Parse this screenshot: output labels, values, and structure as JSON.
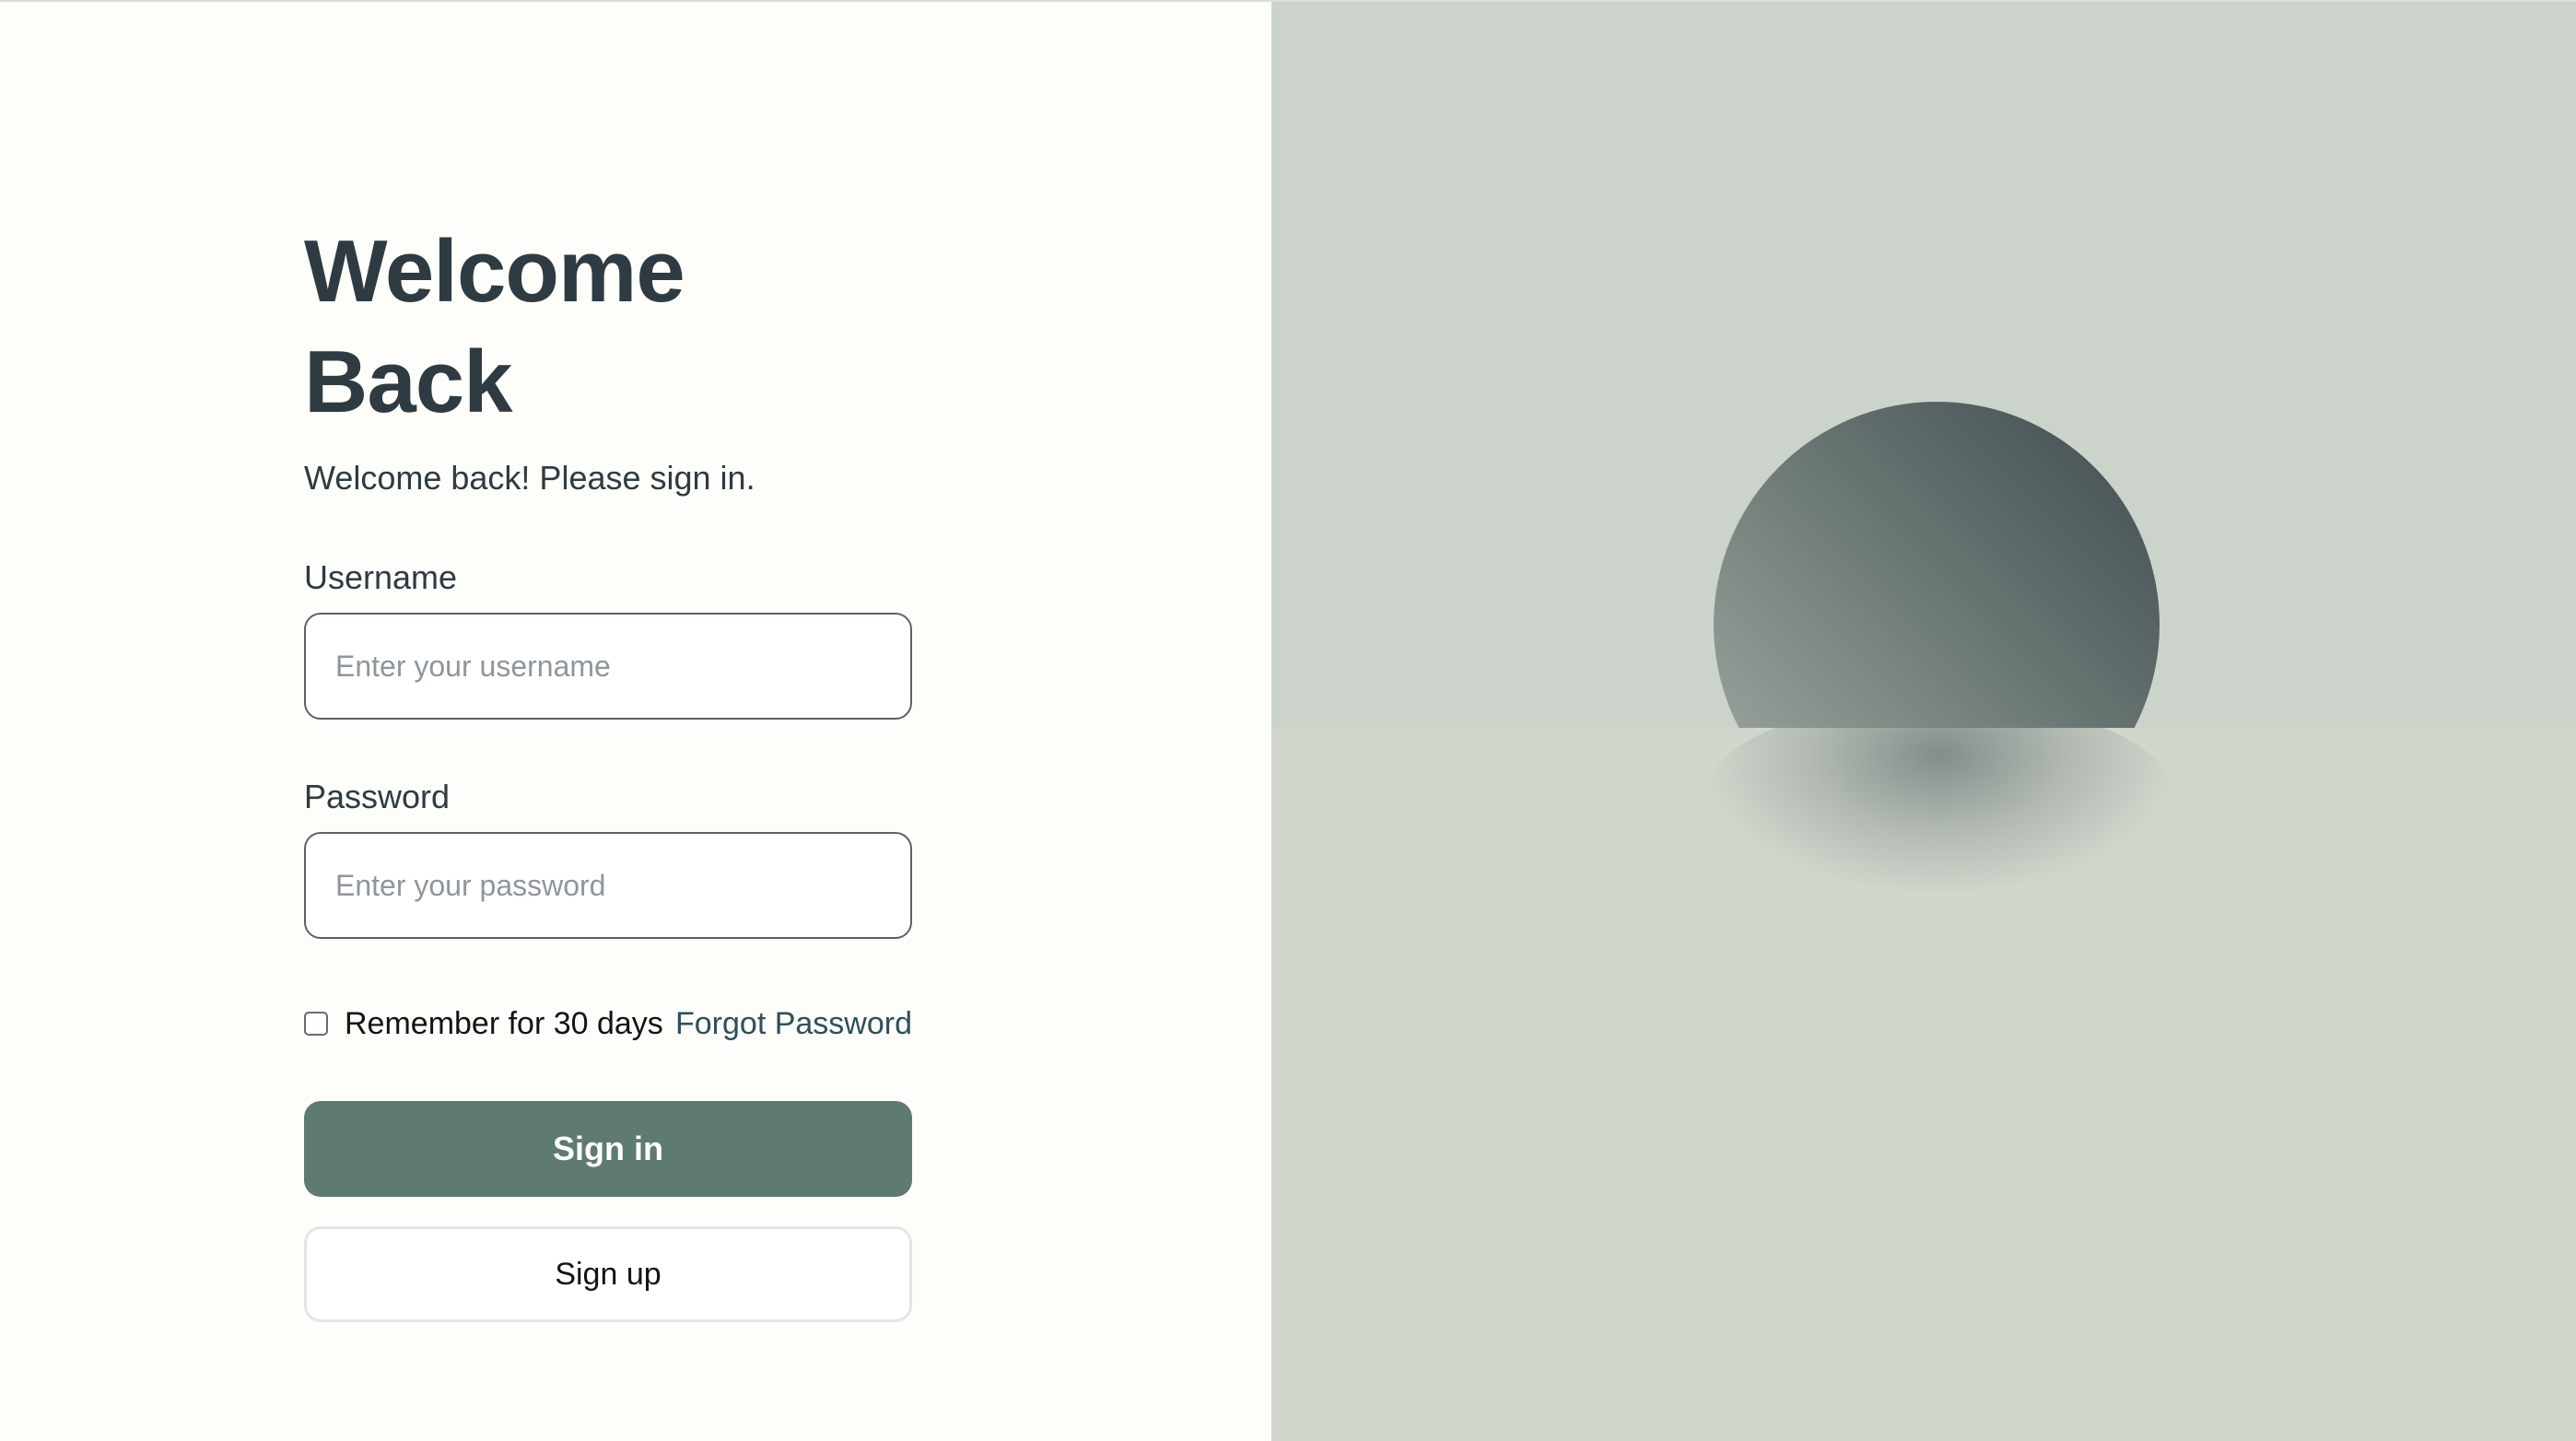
{
  "login": {
    "title": "Welcome Back",
    "subtitle": "Welcome back! Please sign in.",
    "username": {
      "label": "Username",
      "placeholder": "Enter your username",
      "value": ""
    },
    "password": {
      "label": "Password",
      "placeholder": "Enter your password",
      "value": ""
    },
    "remember": {
      "label": "Remember for 30 days",
      "checked": false
    },
    "forgot_label": "Forgot Password",
    "signin_label": "Sign in",
    "signup_label": "Sign up"
  },
  "colors": {
    "primary_button": "#5e7a72",
    "heading": "#2f3b42",
    "link": "#2f4f5a",
    "right_panel": "#d1d7cd",
    "left_panel": "#fdfdfa"
  },
  "illustration": {
    "icon": "sphere-illustration"
  }
}
